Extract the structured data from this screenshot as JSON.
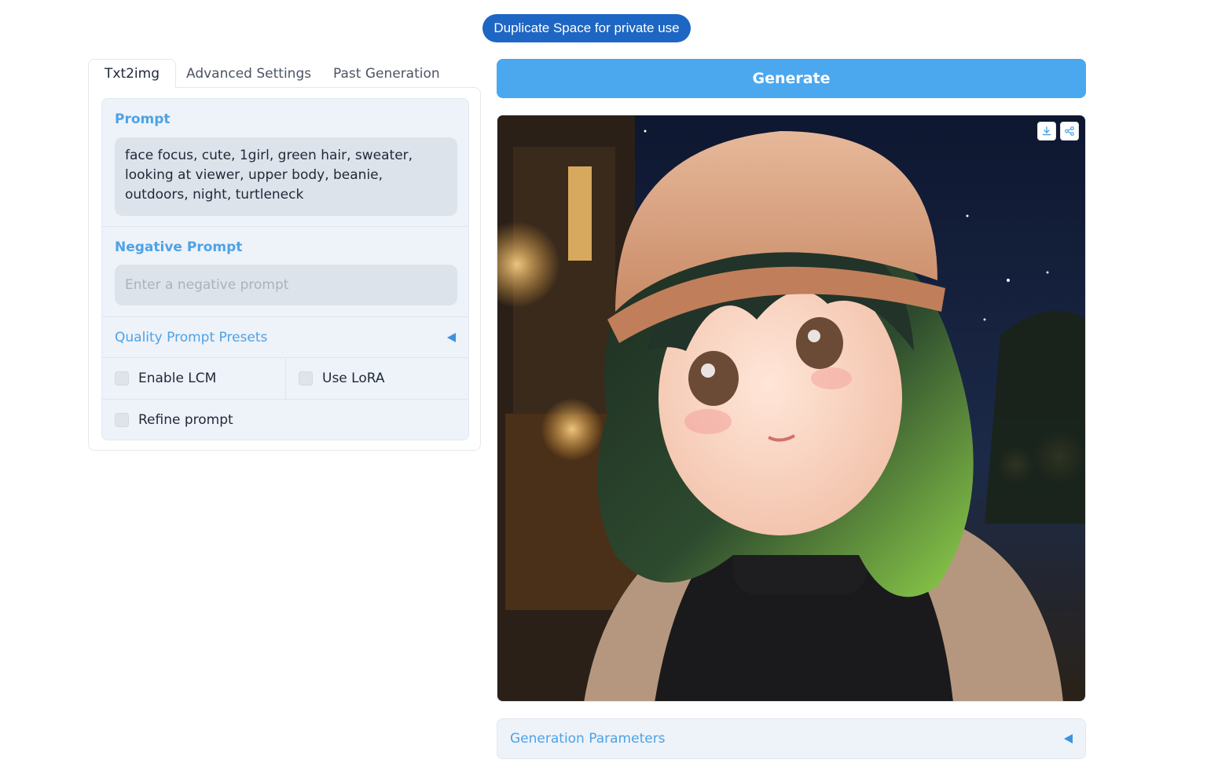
{
  "header": {
    "duplicate_label": "Duplicate Space for private use"
  },
  "tabs": [
    {
      "label": "Txt2img",
      "active": true
    },
    {
      "label": "Advanced Settings",
      "active": false
    },
    {
      "label": "Past Generation",
      "active": false
    }
  ],
  "form": {
    "prompt_label": "Prompt",
    "prompt_value": "face focus, cute, 1girl, green hair, sweater, looking at viewer, upper body, beanie, outdoors, night, turtleneck",
    "negative_label": "Negative Prompt",
    "negative_placeholder": "Enter a negative prompt",
    "negative_value": "",
    "quality_presets_label": "Quality Prompt Presets",
    "enable_lcm_label": "Enable LCM",
    "enable_lcm_checked": false,
    "use_lora_label": "Use LoRA",
    "use_lora_checked": false,
    "refine_prompt_label": "Refine prompt",
    "refine_prompt_checked": false
  },
  "output": {
    "generate_label": "Generate",
    "icons": [
      "download-icon",
      "share-icon"
    ],
    "generation_params_label": "Generation Parameters"
  },
  "colors": {
    "accent": "#4da3e6",
    "generate_button": "#4ba7ee",
    "duplicate_button": "#1e66c4",
    "panel_bg": "#eef2f9",
    "input_bg": "#dde3eb"
  }
}
